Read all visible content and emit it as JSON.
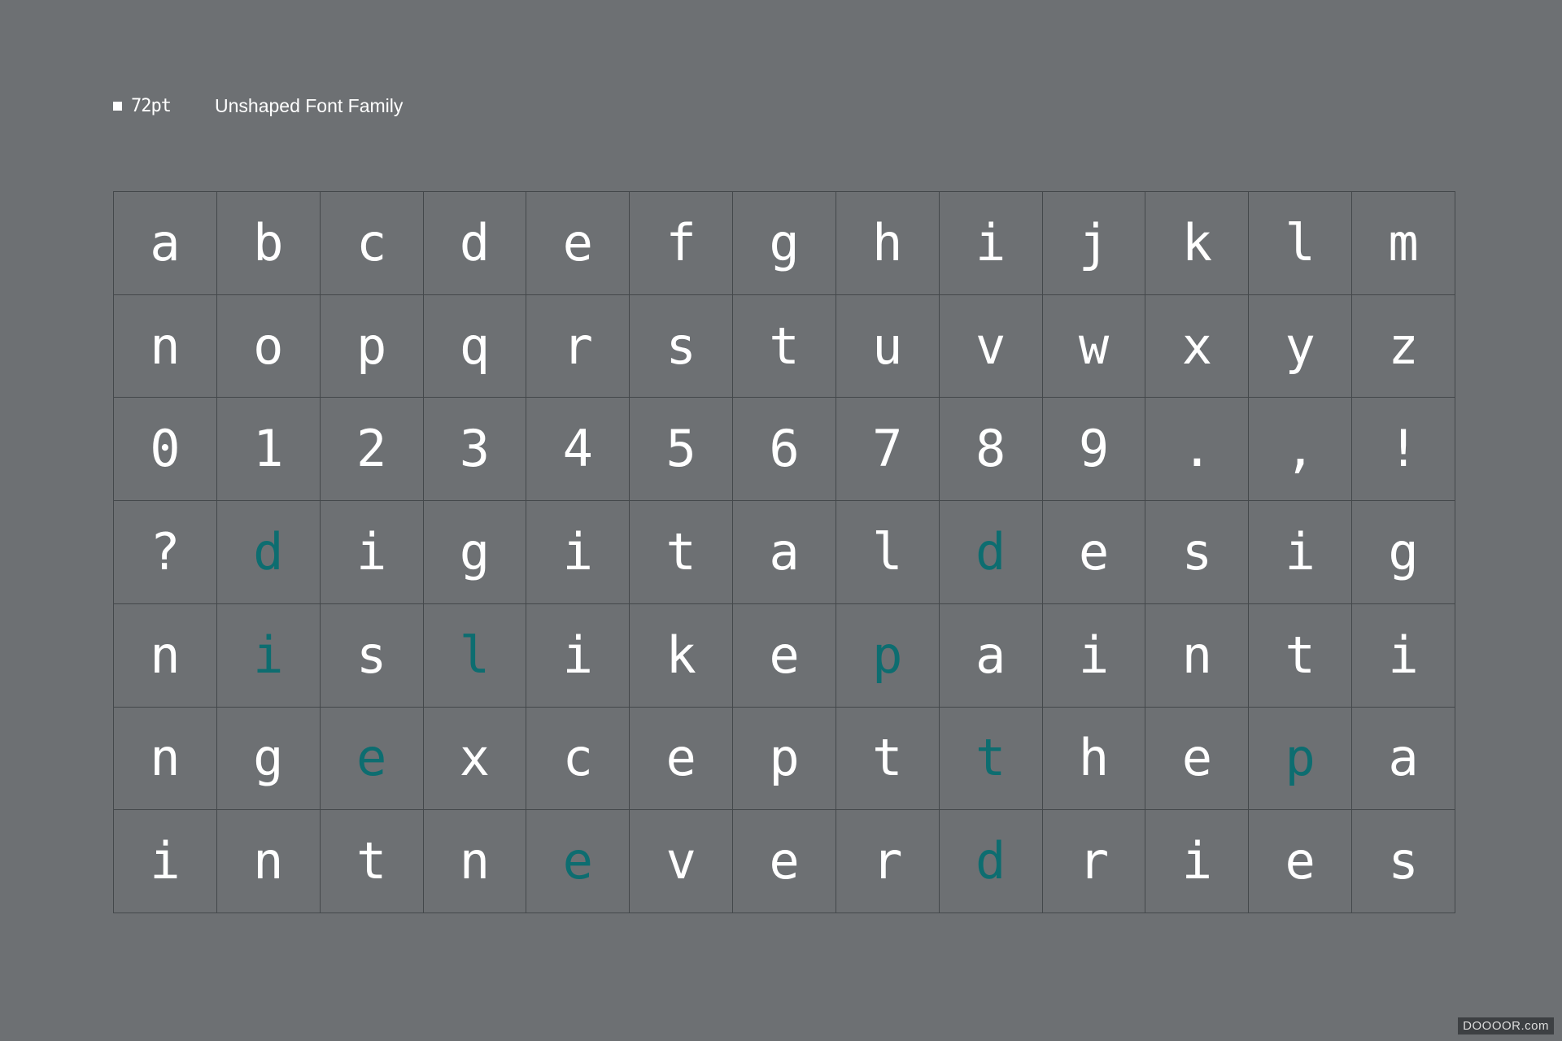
{
  "header": {
    "size_label": "72pt",
    "family_title": "Unshaped Font Family"
  },
  "colors": {
    "background": "#6d7073",
    "glyph": "#ffffff",
    "accent": "#0d6d70",
    "grid_line": "#44484b"
  },
  "grid": {
    "rows": [
      [
        {
          "c": "a"
        },
        {
          "c": "b"
        },
        {
          "c": "c"
        },
        {
          "c": "d"
        },
        {
          "c": "e"
        },
        {
          "c": "f"
        },
        {
          "c": "g"
        },
        {
          "c": "h"
        },
        {
          "c": "i"
        },
        {
          "c": "j"
        },
        {
          "c": "k"
        },
        {
          "c": "l"
        },
        {
          "c": "m"
        }
      ],
      [
        {
          "c": "n"
        },
        {
          "c": "o"
        },
        {
          "c": "p"
        },
        {
          "c": "q"
        },
        {
          "c": "r"
        },
        {
          "c": "s"
        },
        {
          "c": "t"
        },
        {
          "c": "u"
        },
        {
          "c": "v"
        },
        {
          "c": "w"
        },
        {
          "c": "x"
        },
        {
          "c": "y"
        },
        {
          "c": "z"
        }
      ],
      [
        {
          "c": "0"
        },
        {
          "c": "1"
        },
        {
          "c": "2"
        },
        {
          "c": "3"
        },
        {
          "c": "4"
        },
        {
          "c": "5"
        },
        {
          "c": "6"
        },
        {
          "c": "7"
        },
        {
          "c": "8"
        },
        {
          "c": "9"
        },
        {
          "c": "."
        },
        {
          "c": ","
        },
        {
          "c": "!"
        }
      ],
      [
        {
          "c": "?"
        },
        {
          "c": "d",
          "accent": true
        },
        {
          "c": "i"
        },
        {
          "c": "g"
        },
        {
          "c": "i"
        },
        {
          "c": "t"
        },
        {
          "c": "a"
        },
        {
          "c": "l"
        },
        {
          "c": "d",
          "accent": true
        },
        {
          "c": "e"
        },
        {
          "c": "s"
        },
        {
          "c": "i"
        },
        {
          "c": "g"
        }
      ],
      [
        {
          "c": "n"
        },
        {
          "c": "i",
          "accent": true
        },
        {
          "c": "s"
        },
        {
          "c": "l",
          "accent": true
        },
        {
          "c": "i"
        },
        {
          "c": "k"
        },
        {
          "c": "e"
        },
        {
          "c": "p",
          "accent": true
        },
        {
          "c": "a"
        },
        {
          "c": "i"
        },
        {
          "c": "n"
        },
        {
          "c": "t"
        },
        {
          "c": "i"
        }
      ],
      [
        {
          "c": "n"
        },
        {
          "c": "g"
        },
        {
          "c": "e",
          "accent": true
        },
        {
          "c": "x"
        },
        {
          "c": "c"
        },
        {
          "c": "e"
        },
        {
          "c": "p"
        },
        {
          "c": "t"
        },
        {
          "c": "t",
          "accent": true
        },
        {
          "c": "h"
        },
        {
          "c": "e"
        },
        {
          "c": "p",
          "accent": true
        },
        {
          "c": "a"
        }
      ],
      [
        {
          "c": "i"
        },
        {
          "c": "n"
        },
        {
          "c": "t"
        },
        {
          "c": "n"
        },
        {
          "c": "e",
          "accent": true
        },
        {
          "c": "v"
        },
        {
          "c": "e"
        },
        {
          "c": "r"
        },
        {
          "c": "d",
          "accent": true
        },
        {
          "c": "r"
        },
        {
          "c": "i"
        },
        {
          "c": "e"
        },
        {
          "c": "s"
        }
      ]
    ]
  },
  "watermark": "DOOOOR.com"
}
